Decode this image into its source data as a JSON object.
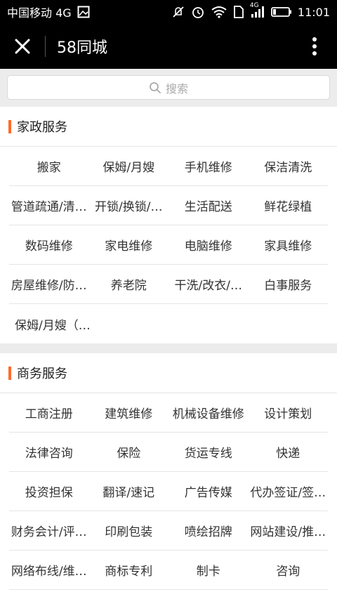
{
  "status_bar": {
    "carrier": "中国移动 4G",
    "network_label": "4G",
    "time": "11:01"
  },
  "title_bar": {
    "title": "58同城"
  },
  "search": {
    "placeholder": "搜索"
  },
  "sections": [
    {
      "title": "家政服务",
      "items": [
        "搬家",
        "保姆/月嫂",
        "手机维修",
        "保洁清洗",
        "管道疏通/清…",
        "开锁/换锁/…",
        "生活配送",
        "鲜花绿植",
        "数码维修",
        "家电维修",
        "电脑维修",
        "家具维修",
        "房屋维修/防…",
        "养老院",
        "干洗/改衣/…",
        "白事服务",
        "保姆/月嫂（…"
      ]
    },
    {
      "title": "商务服务",
      "items": [
        "工商注册",
        "建筑维修",
        "机械设备维修",
        "设计策划",
        "法律咨询",
        "保险",
        "货运专线",
        "快递",
        "投资担保",
        "翻译/速记",
        "广告传媒",
        "代办签证/签…",
        "财务会计/评…",
        "印刷包装",
        "喷绘招牌",
        "网站建设/推…",
        "网络布线/维…",
        "商标专利",
        "制卡",
        "咨询"
      ]
    }
  ]
}
